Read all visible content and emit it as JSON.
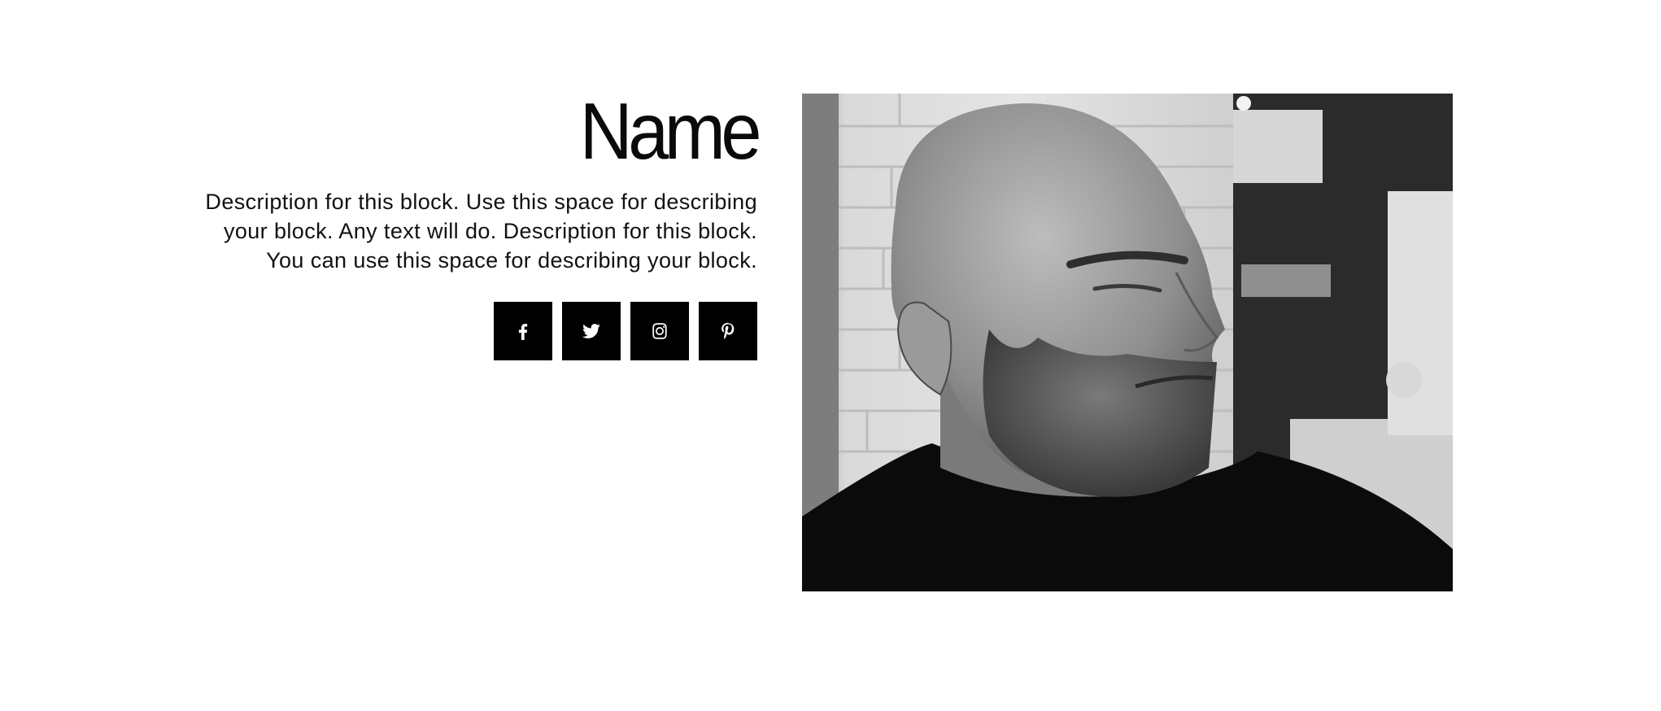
{
  "profile": {
    "name": "Name",
    "description_lines": [
      "Description for this block. Use this space for describing",
      "your block. Any text will do. Description for this block.",
      "You can use this space for describing your block."
    ]
  },
  "social": {
    "items": [
      {
        "icon": "facebook-icon"
      },
      {
        "icon": "twitter-icon"
      },
      {
        "icon": "instagram-icon"
      },
      {
        "icon": "pinterest-icon"
      }
    ],
    "button_color": "#000000",
    "icon_color": "#ffffff"
  },
  "photo": {
    "style": "black-and-white portrait"
  }
}
